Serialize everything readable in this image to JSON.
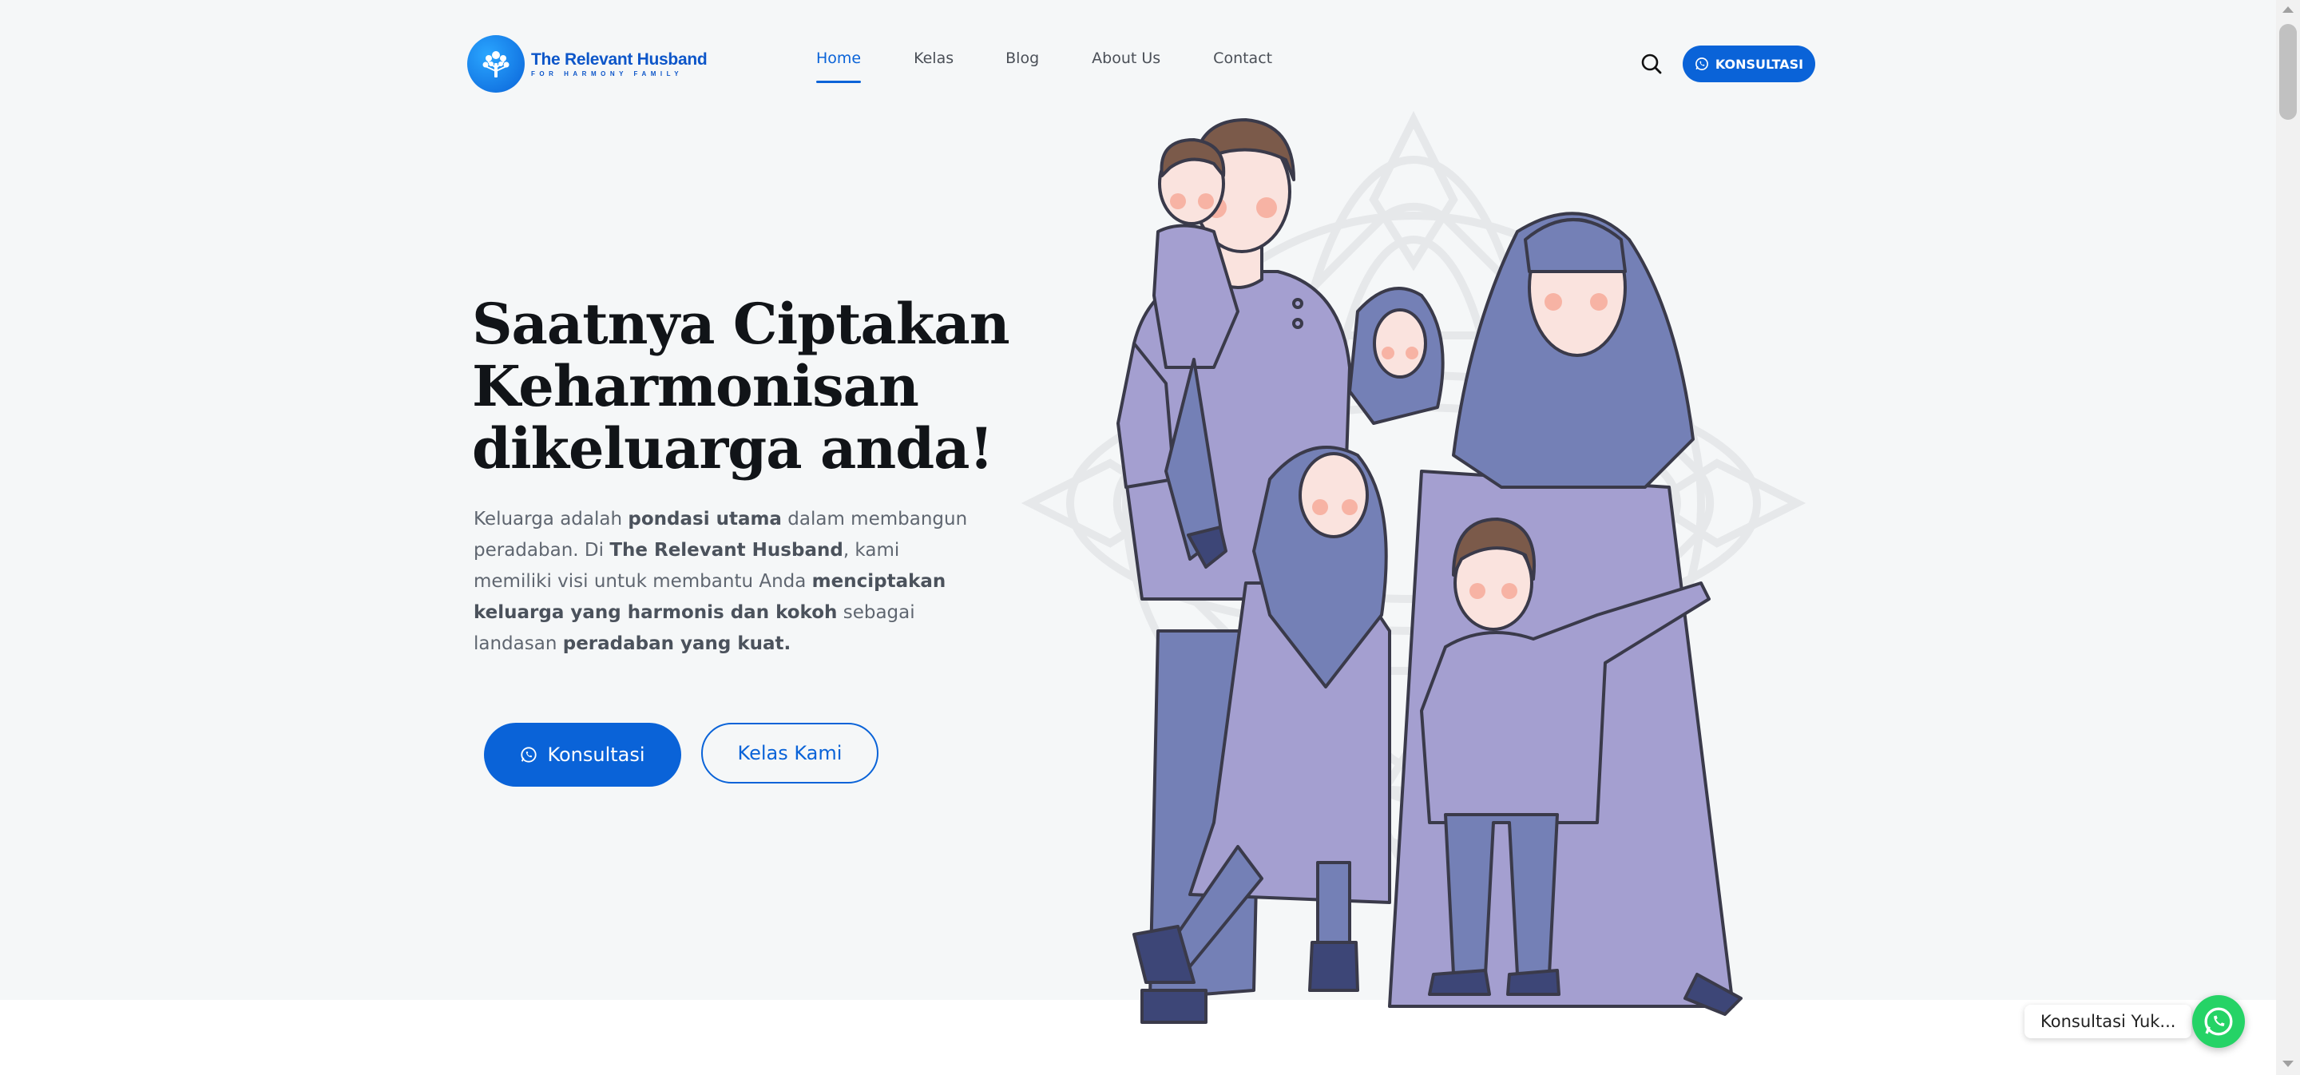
{
  "header": {
    "logo_title": "The Relevant Husband",
    "logo_tagline": "FOR HARMONY FAMILY",
    "nav": [
      {
        "label": "Home",
        "active": true
      },
      {
        "label": "Kelas",
        "active": false
      },
      {
        "label": "Blog",
        "active": false
      },
      {
        "label": "About Us",
        "active": false
      },
      {
        "label": "Contact",
        "active": false
      }
    ],
    "search_icon": "search-icon",
    "cta_label": "KONSULTASI",
    "cta_icon": "whatsapp-icon"
  },
  "hero": {
    "title_lines": [
      "Saatnya Ciptakan",
      "Keharmonisan",
      "dikeluarga anda!"
    ],
    "description": [
      {
        "text": "Keluarga adalah ",
        "bold": false
      },
      {
        "text": "pondasi utama",
        "bold": true
      },
      {
        "text": " dalam membangun peradaban. Di ",
        "bold": false
      },
      {
        "text": "The Relevant Husband",
        "bold": true
      },
      {
        "text": ", kami memiliki visi untuk membantu Anda ",
        "bold": false
      },
      {
        "text": "menciptakan keluarga yang harmonis dan kokoh",
        "bold": true
      },
      {
        "text": " sebagai landasan ",
        "bold": false
      },
      {
        "text": "peradaban yang kuat.",
        "bold": true
      }
    ],
    "primary_button": "Konsultasi",
    "secondary_button": "Kelas Kami"
  },
  "floating_chat": {
    "label": "Konsultasi Yuk...",
    "icon": "whatsapp-icon"
  },
  "colors": {
    "brand_blue": "#0a63d8",
    "hero_bg": "#f5f7f8",
    "whatsapp_green": "#25d366",
    "illustration_purple": "#a49fd0",
    "illustration_indigo": "#7480b6"
  }
}
